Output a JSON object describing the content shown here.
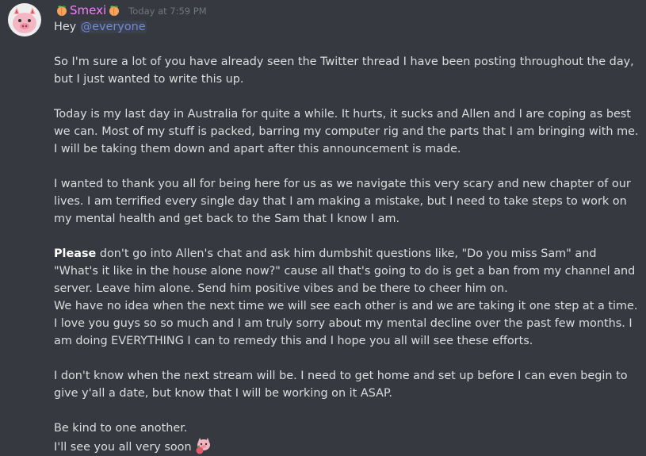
{
  "message": {
    "username": "Smexi",
    "timestamp": "Today at 7:59 PM",
    "greeting_prefix": "Hey ",
    "mention": "@everyone",
    "paragraphs": {
      "p1": "So I'm sure a lot of you have already seen the Twitter thread I have been posting throughout the day, but I just wanted to write this up.",
      "p2": "Today is my last day in Australia for quite a while. It hurts, it sucks and Allen and I are coping as best we can. Most of my stuff is packed, barring my computer rig and the parts that I am bringing with me. I will be taking them down and apart after this announcement is made.",
      "p3": "I wanted to thank you all for being here for us as we navigate this very scary and new chapter of our lives. I am terrified every single day that I am making a mistake, but I need to take steps to work on my mental health and get back to the Sam that I know I am.",
      "p4_bold": "Please",
      "p4_rest": " don't go into Allen's chat and ask him dumbshit questions like, \"Do you miss Sam\" and \"What's it like in the house alone now?\" cause all that's going to do is get a ban from my channel and server. Leave him alone. Send him positive vibes and be there to cheer him on.",
      "p5": "We have no idea when the next time we will see each other is and we are taking it one step at a time.",
      "p6": "I love you guys so so much and I am truly sorry about my mental decline over the past few months. I am doing EVERYTHING I can to remedy this and I hope you all will see these efforts.",
      "p7": "I don't know when the next stream will be. I need to get home and set up before I can even begin to give y'all a date, but know that I will be working on it ASAP.",
      "p8": "Be kind to one another.",
      "p9": "I'll see you all very soon"
    }
  },
  "icons": {
    "avatar": "pig-avatar",
    "username_badges": "peach-icon",
    "end_emoji": "pig-hugging-peach-icon"
  },
  "colors": {
    "background": "#36393f",
    "username": "#f47fff",
    "mention": "#7289da",
    "text": "#dcddde",
    "timestamp": "#72767d"
  }
}
